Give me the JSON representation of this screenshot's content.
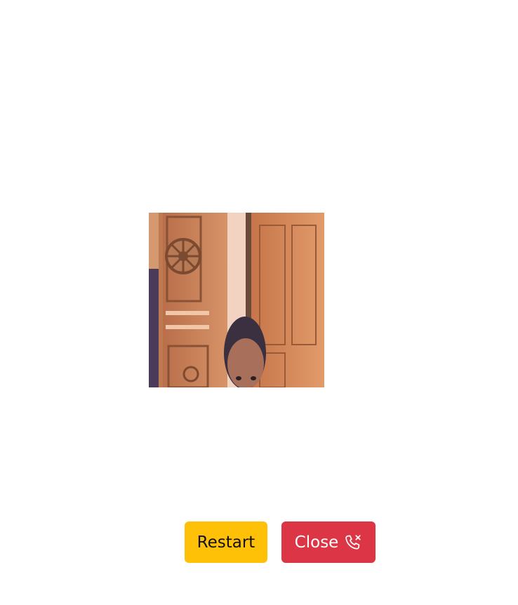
{
  "video": {
    "description_icon": "camera-feed"
  },
  "controls": {
    "restart_label": "Restart",
    "close_label": "Close",
    "close_icon": "phone-x-icon",
    "restart_color": "#ffc107",
    "close_color": "#dc3545"
  }
}
